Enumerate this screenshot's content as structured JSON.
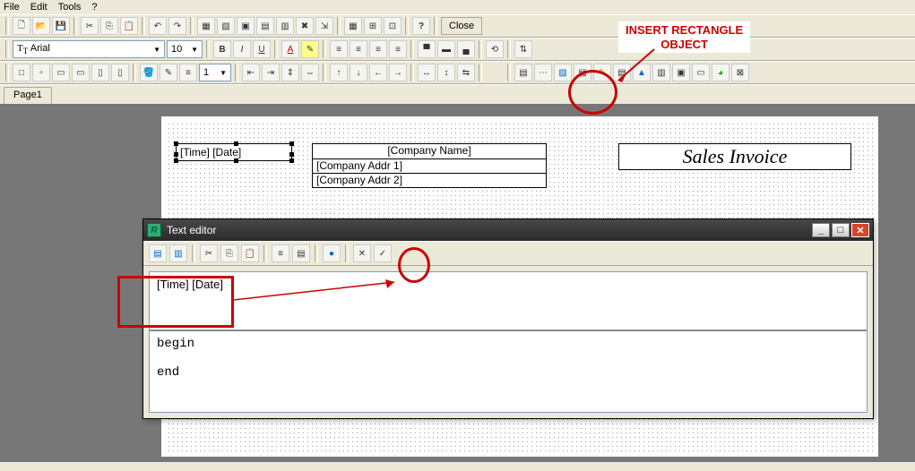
{
  "menubar": {
    "file": "File",
    "edit": "Edit",
    "tools": "Tools",
    "help": "?"
  },
  "toolbar1": {
    "close": "Close"
  },
  "font": {
    "name": "Arial",
    "size": "10"
  },
  "callout": {
    "line1": "INSERT RECTANGLE",
    "line2": "OBJECT"
  },
  "tabs": {
    "page1": "Page1"
  },
  "page": {
    "time_date": "[Time] [Date]",
    "company_name": "[Company Name]",
    "company_addr1": "[Company Addr 1]",
    "company_addr2": "[Company Addr 2]",
    "invoice_title": "Sales Invoice"
  },
  "texteditor": {
    "title": "Text editor",
    "text": "[Time] [Date]",
    "code": "begin\n\nend"
  },
  "line_width": "1"
}
